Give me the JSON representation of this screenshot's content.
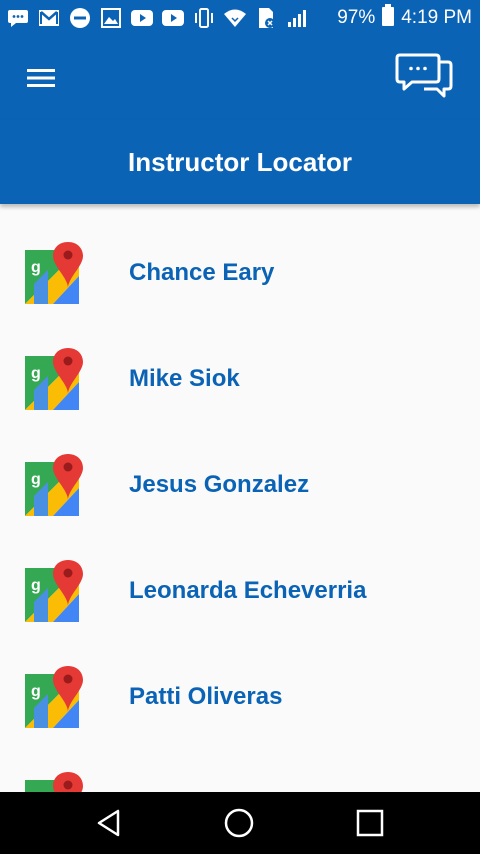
{
  "status_bar": {
    "battery": "97%",
    "time": "4:19 PM"
  },
  "header": {
    "title": "Instructor Locator"
  },
  "instructors": [
    {
      "name": "Chance Eary"
    },
    {
      "name": "Mike Siok"
    },
    {
      "name": "Jesus Gonzalez"
    },
    {
      "name": "Leonarda Echeverria"
    },
    {
      "name": "Patti Oliveras"
    }
  ],
  "colors": {
    "primary": "#0b63b6",
    "name_text": "#0b63b6",
    "nav_bar": "#000000"
  },
  "icons": {
    "menu": "hamburger-menu-icon",
    "chat": "chat-bubbles-icon",
    "list_item": "google-maps-icon",
    "nav_back": "back-triangle-icon",
    "nav_home": "home-circle-icon",
    "nav_recents": "recents-square-icon"
  }
}
